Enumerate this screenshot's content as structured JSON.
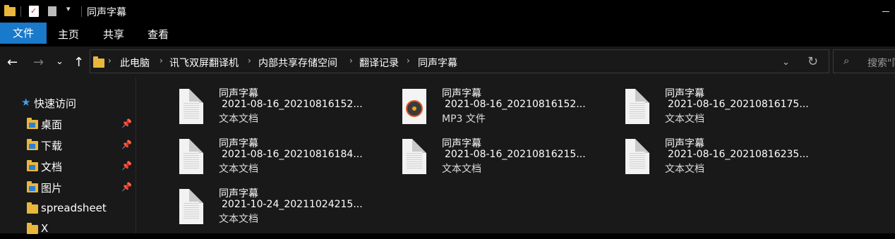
{
  "window": {
    "title": "同声字幕",
    "quick_access_toolbar": [
      "folder-icon",
      "properties-icon",
      "new-folder-icon",
      "customize-dropdown-icon"
    ]
  },
  "ribbon": {
    "tabs": [
      {
        "label": "文件",
        "active": true
      },
      {
        "label": "主页"
      },
      {
        "label": "共享"
      },
      {
        "label": "查看"
      }
    ]
  },
  "address": {
    "crumbs": [
      "此电脑",
      "讯飞双屏翻译机",
      "内部共享存储空间",
      "翻译记录",
      "同声字幕"
    ],
    "search_placeholder": "搜索\"同声字幕\""
  },
  "sidebar": {
    "quick_access_label": "快速访问",
    "items": [
      {
        "label": "桌面",
        "pinned": true
      },
      {
        "label": "下载",
        "pinned": true
      },
      {
        "label": "文档",
        "pinned": true
      },
      {
        "label": "图片",
        "pinned": true
      },
      {
        "label": "spreadsheet",
        "pinned": false
      },
      {
        "label": "X",
        "pinned": false
      }
    ]
  },
  "files": [
    {
      "name": "同声字幕",
      "detail": "2021-08-16_20210816152...",
      "type": "文本文档",
      "icon": "text-document-icon"
    },
    {
      "name": "同声字幕",
      "detail": "2021-08-16_20210816152...",
      "type": "MP3 文件",
      "icon": "mp3-file-icon"
    },
    {
      "name": "同声字幕",
      "detail": "2021-08-16_20210816175...",
      "type": "文本文档",
      "icon": "text-document-icon"
    },
    {
      "name": "同声字幕",
      "detail": "2021-08-16_20210816184...",
      "type": "文本文档",
      "icon": "text-document-icon"
    },
    {
      "name": "同声字幕",
      "detail": "2021-08-16_20210816215...",
      "type": "文本文档",
      "icon": "text-document-icon"
    },
    {
      "name": "同声字幕",
      "detail": "2021-08-16_20210816235...",
      "type": "文本文档",
      "icon": "text-document-icon"
    },
    {
      "name": "同声字幕",
      "detail": "2021-10-24_20211024215...",
      "type": "文本文档",
      "icon": "text-document-icon"
    }
  ],
  "colors": {
    "accent": "#1979ca",
    "background": "#191919",
    "folder": "#e8b73b"
  }
}
